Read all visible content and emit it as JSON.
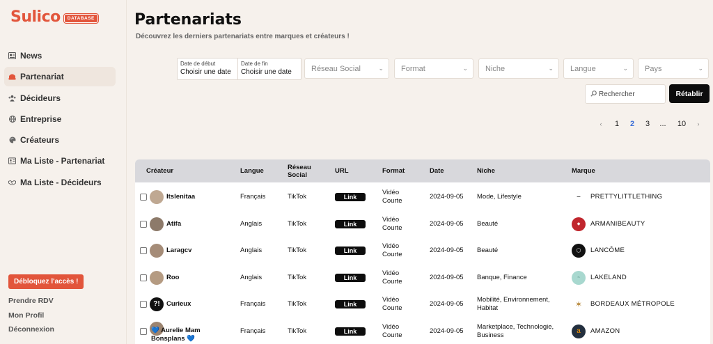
{
  "app": {
    "logo_text": "Sulico",
    "logo_badge": "DATABASE",
    "accent_color": "#e2553b"
  },
  "sidebar": {
    "items": [
      {
        "label": "News",
        "icon": "newspaper-icon"
      },
      {
        "label": "Partenariat",
        "icon": "handshake-icon",
        "active": true
      },
      {
        "label": "Décideurs",
        "icon": "people-icon"
      },
      {
        "label": "Entreprise",
        "icon": "globe-icon"
      },
      {
        "label": "Créateurs",
        "icon": "palette-icon"
      },
      {
        "label": "Ma Liste - Partenariat",
        "icon": "id-card-icon"
      },
      {
        "label": "Ma Liste - Décideurs",
        "icon": "handshake-outline-icon"
      }
    ],
    "unlock_label": "Débloquez l'accès !",
    "links": [
      "Prendre RDV",
      "Mon Profil",
      "Déconnexion"
    ]
  },
  "main": {
    "title": "Partenariats",
    "subtitle": "Découvrez les derniers partenariats entre marques et créateurs !"
  },
  "filters": {
    "date_start_label": "Date de début",
    "date_start_value": "Choisir une date",
    "date_end_label": "Date de fin",
    "date_end_value": "Choisir une date",
    "selects": [
      "Réseau Social",
      "Format",
      "Niche",
      "Langue",
      "Pays"
    ],
    "search_placeholder": "Rechercher",
    "reset_label": "Rétablir"
  },
  "pagination": {
    "prev": "‹",
    "pages": [
      "1",
      "2",
      "3",
      "...",
      "10"
    ],
    "current": "2",
    "next": "›"
  },
  "table": {
    "headers": [
      "Créateur",
      "Langue",
      "Réseau Social",
      "URL",
      "Format",
      "Date",
      "Niche",
      "Marque"
    ],
    "link_label": "Link",
    "rows": [
      {
        "creator": "Itslenitaa",
        "language": "Français",
        "network": "TikTok",
        "format": "Vidéo Courte",
        "date": "2024-09-05",
        "niche": "Mode, Lifestyle",
        "brand": "PRETTYLITTLETHING",
        "brand_color": "#ffffff"
      },
      {
        "creator": "Atifa",
        "language": "Anglais",
        "network": "TikTok",
        "format": "Vidéo Courte",
        "date": "2024-09-05",
        "niche": "Beauté",
        "brand": "ARMANIBEAUTY",
        "brand_color": "#c0262d"
      },
      {
        "creator": "Laragcv",
        "language": "Anglais",
        "network": "TikTok",
        "format": "Vidéo Courte",
        "date": "2024-09-05",
        "niche": "Beauté",
        "brand": "LANCÔME",
        "brand_color": "#111111"
      },
      {
        "creator": "Roo",
        "language": "Anglais",
        "network": "TikTok",
        "format": "Vidéo Courte",
        "date": "2024-09-05",
        "niche": "Banque, Finance",
        "brand": "LAKELAND",
        "brand_color": "#a8d8cf"
      },
      {
        "creator": "Curieux",
        "language": "Français",
        "network": "TikTok",
        "format": "Vidéo Courte",
        "date": "2024-09-05",
        "niche": "Mobilité, Environnement, Habitat",
        "brand": "BORDEAUX MÉTROPOLE",
        "brand_color": "#ffffff"
      },
      {
        "creator": "💙 Aurelie Mam Bonsplans 💙",
        "language": "Français",
        "network": "TikTok",
        "format": "Vidéo Courte",
        "date": "2024-09-05",
        "niche": "Marketplace, Technologie, Business",
        "brand": "AMAZON",
        "brand_color": "#232f3e"
      }
    ]
  }
}
